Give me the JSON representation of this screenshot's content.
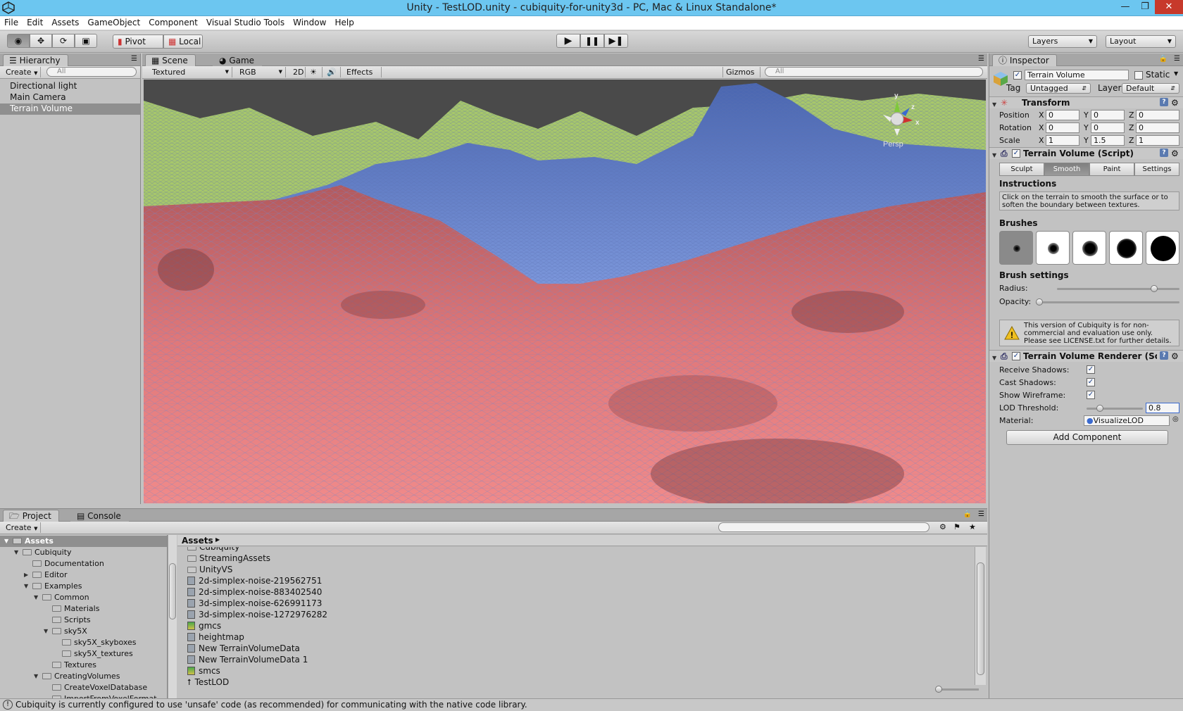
{
  "window": {
    "title": "Unity - TestLOD.unity - cubiquity-for-unity3d - PC, Mac & Linux Standalone*"
  },
  "menu": [
    "File",
    "Edit",
    "Assets",
    "GameObject",
    "Component",
    "Visual Studio Tools",
    "Window",
    "Help"
  ],
  "toolbar": {
    "pivot": "Pivot",
    "local": "Local",
    "layers": "Layers",
    "layout": "Layout"
  },
  "hierarchy": {
    "tab": "Hierarchy",
    "create": "Create",
    "search": "All",
    "items": [
      "Directional light",
      "Main Camera",
      "Terrain Volume"
    ],
    "selected": 2
  },
  "scene": {
    "tab_scene": "Scene",
    "tab_game": "Game",
    "render_mode": "Textured",
    "color_mode": "RGB",
    "btn_2d": "2D",
    "effects": "Effects",
    "gizmos": "Gizmos",
    "search": "All",
    "persp": "Persp",
    "axis_y": "y",
    "axis_z": "z",
    "axis_x": "x"
  },
  "inspector": {
    "tab": "Inspector",
    "object_name": "Terrain Volume",
    "static_label": "Static",
    "tag_label": "Tag",
    "tag_value": "Untagged",
    "layer_label": "Layer",
    "layer_value": "Default",
    "transform": {
      "title": "Transform",
      "position": {
        "label": "Position",
        "x": "0",
        "y": "0",
        "z": "0"
      },
      "rotation": {
        "label": "Rotation",
        "x": "0",
        "y": "0",
        "z": "0"
      },
      "scale": {
        "label": "Scale",
        "x": "1",
        "y": "1.5",
        "z": "1"
      }
    },
    "script": {
      "title": "Terrain Volume (Script)",
      "tabs": [
        "Sculpt",
        "Smooth",
        "Paint",
        "Settings"
      ],
      "active_tab": 1,
      "instructions_label": "Instructions",
      "instructions_text": "Click on the terrain to smooth the surface or to soften the boundary between textures.",
      "brushes_label": "Brushes",
      "brush_settings_label": "Brush settings",
      "radius_label": "Radius:",
      "radius_value": 0.81,
      "opacity_label": "Opacity:",
      "opacity_value": 0.0,
      "warning": "This version of Cubiquity is for non-commercial and evaluation use only. Please see LICENSE.txt for further details."
    },
    "renderer": {
      "title": "Terrain Volume Renderer (Sc",
      "receive_shadows": "Receive Shadows:",
      "cast_shadows": "Cast Shadows:",
      "show_wireframe": "Show Wireframe:",
      "lod_label": "LOD Threshold:",
      "lod_value": "0.8",
      "lod_fraction": 0.2,
      "material_label": "Material:",
      "material_value": "VisualizeLOD"
    },
    "add_component": "Add Component"
  },
  "project": {
    "tab_project": "Project",
    "tab_console": "Console",
    "create": "Create",
    "tree": [
      {
        "label": "Assets",
        "depth": 0,
        "open": true
      },
      {
        "label": "Cubiquity",
        "depth": 1,
        "open": true
      },
      {
        "label": "Documentation",
        "depth": 2,
        "open": null
      },
      {
        "label": "Editor",
        "depth": 2,
        "open": false
      },
      {
        "label": "Examples",
        "depth": 2,
        "open": true
      },
      {
        "label": "Common",
        "depth": 3,
        "open": true
      },
      {
        "label": "Materials",
        "depth": 4,
        "open": null
      },
      {
        "label": "Scripts",
        "depth": 4,
        "open": null
      },
      {
        "label": "sky5X",
        "depth": 4,
        "open": true
      },
      {
        "label": "sky5X_skyboxes",
        "depth": 5,
        "open": null
      },
      {
        "label": "sky5X_textures",
        "depth": 5,
        "open": null
      },
      {
        "label": "Textures",
        "depth": 4,
        "open": null
      },
      {
        "label": "CreatingVolumes",
        "depth": 3,
        "open": true
      },
      {
        "label": "CreateVoxelDatabase",
        "depth": 4,
        "open": null
      },
      {
        "label": "ImportFromVoxelFormat",
        "depth": 4,
        "open": null
      }
    ],
    "breadcrumb": "Assets",
    "files": [
      {
        "label": "Cubiquity",
        "type": "folder"
      },
      {
        "label": "StreamingAssets",
        "type": "folder"
      },
      {
        "label": "UnityVS",
        "type": "folder"
      },
      {
        "label": "2d-simplex-noise-219562751",
        "type": "asset"
      },
      {
        "label": "2d-simplex-noise-883402540",
        "type": "asset"
      },
      {
        "label": "3d-simplex-noise-626991173",
        "type": "asset"
      },
      {
        "label": "3d-simplex-noise-1272976282",
        "type": "asset"
      },
      {
        "label": "gmcs",
        "type": "text"
      },
      {
        "label": "heightmap",
        "type": "asset"
      },
      {
        "label": "New TerrainVolumeData",
        "type": "asset"
      },
      {
        "label": "New TerrainVolumeData 1",
        "type": "asset"
      },
      {
        "label": "smcs",
        "type": "text"
      },
      {
        "label": "TestLOD",
        "type": "scene"
      }
    ]
  },
  "status": "Cubiquity is currently configured to use 'unsafe' code (as recommended) for communicating with the native code library."
}
